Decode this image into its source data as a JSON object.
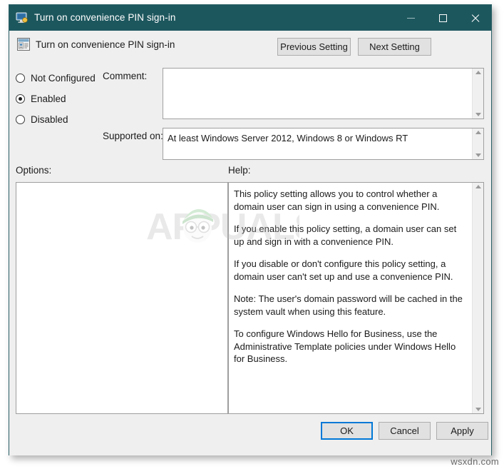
{
  "window": {
    "title": "Turn on convenience PIN sign-in",
    "title_icon": "computer-monitor-icon",
    "minimize_label": "Minimize",
    "maximize_label": "Maximize",
    "close_label": "Close",
    "border_color": "#2a6166",
    "titlebar_color": "#1d575e",
    "background_color": "#efefef"
  },
  "header": {
    "policy_icon": "group-policy-setting-icon",
    "policy_title": "Turn on convenience PIN sign-in",
    "previous_setting_label": "Previous Setting",
    "next_setting_label": "Next Setting"
  },
  "state": {
    "options": [
      {
        "id": "not-configured",
        "label": "Not Configured",
        "checked": false
      },
      {
        "id": "enabled",
        "label": "Enabled",
        "checked": true
      },
      {
        "id": "disabled",
        "label": "Disabled",
        "checked": false
      }
    ],
    "selected": "Enabled"
  },
  "comment": {
    "label": "Comment:",
    "value": "",
    "placeholder": ""
  },
  "supported_on": {
    "label": "Supported on:",
    "value": "At least Windows Server 2012, Windows 8 or Windows RT"
  },
  "options_pane": {
    "label": "Options:",
    "content": ""
  },
  "help_pane": {
    "label": "Help:",
    "paragraphs": [
      "This policy setting allows you to control whether a domain user can sign in using a convenience PIN.",
      "If you enable this policy setting, a domain user can set up and sign in with a convenience PIN.",
      "If you disable or don't configure this policy setting, a domain user can't set up and use a convenience PIN.",
      "Note: The user's domain password will be cached in the system vault when using this feature.",
      "To configure Windows Hello for Business, use the Administrative Template policies under Windows Hello for Business."
    ]
  },
  "footer": {
    "ok_label": "OK",
    "cancel_label": "Cancel",
    "apply_label": "Apply",
    "default_button": "OK",
    "focus_color": "#0078d7"
  },
  "watermarks": {
    "center_text": "APPUALS",
    "bottom_text": "wsxdn.com"
  },
  "scrollbars": {
    "up_arrow": "chevron-up-icon",
    "down_arrow": "chevron-down-icon"
  }
}
